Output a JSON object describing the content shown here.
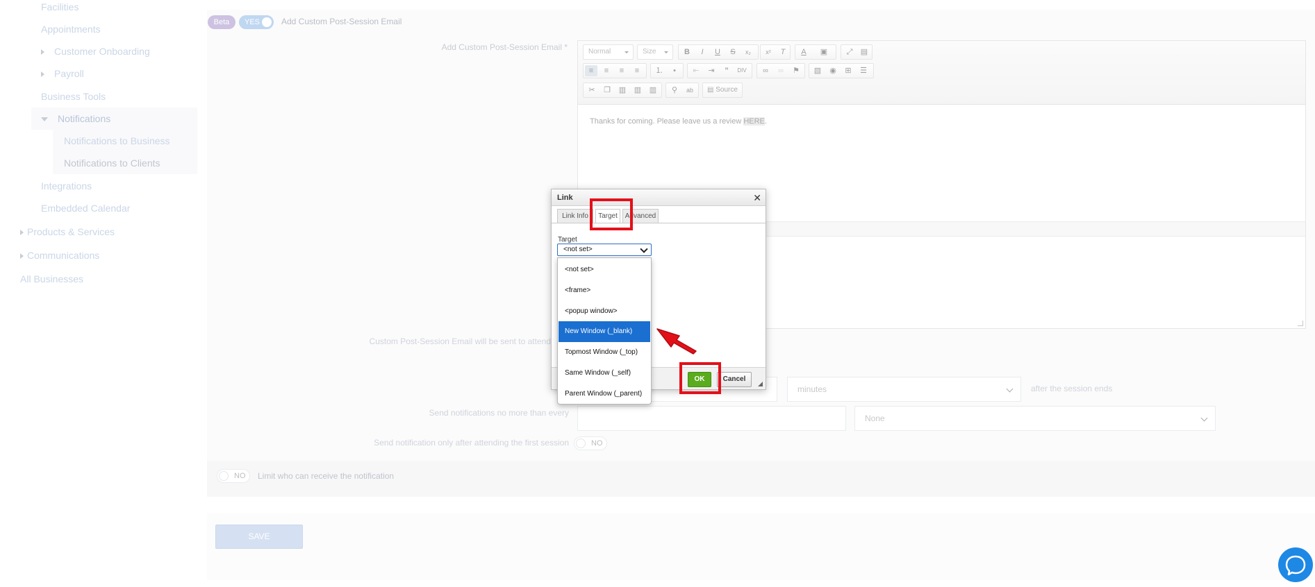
{
  "sidebar": {
    "items": [
      {
        "label": "Facilities"
      },
      {
        "label": "Appointments"
      },
      {
        "label": "Customer Onboarding"
      },
      {
        "label": "Payroll"
      },
      {
        "label": "Business Tools"
      },
      {
        "label": "Notifications"
      },
      {
        "label": "Notifications to Business"
      },
      {
        "label": "Notifications to Clients"
      },
      {
        "label": "Integrations"
      },
      {
        "label": "Embedded Calendar"
      },
      {
        "label": "Products & Services"
      },
      {
        "label": "Communications"
      },
      {
        "label": "All Businesses"
      }
    ]
  },
  "header": {
    "beta_badge": "Beta",
    "toggle_label": "YES",
    "title": "Add Custom Post-Session Email"
  },
  "form": {
    "email_label": "Add Custom Post-Session Email *",
    "sent_to_label": "Custom Post-Session Email will be sent to attend",
    "time_unit": "minutes",
    "after_text": "after the session ends",
    "no_more_label": "Send notifications no more than every",
    "no_more_unit": "None",
    "first_session_label": "Send notification only after attending the first session",
    "first_session_toggle": "NO",
    "limit_toggle": "NO",
    "limit_label": "Limit who can receive the notification",
    "save_button": "SAVE"
  },
  "editor": {
    "format_combo": "Normal",
    "size_combo": "Size",
    "source_button": "Source",
    "body_text": "Thanks for coming. Please leave us a review ",
    "body_link": "HERE",
    "body_end": "."
  },
  "dialog": {
    "title": "Link",
    "tabs": [
      "Link Info",
      "Target",
      "Advanced"
    ],
    "target_label": "Target",
    "target_value": "<not set>",
    "ok_button": "OK",
    "cancel_button": "Cancel",
    "options": [
      "<not set>",
      "<frame>",
      "<popup window>",
      "New Window (_blank)",
      "Topmost Window (_top)",
      "Same Window (_self)",
      "Parent Window (_parent)"
    ],
    "highlighted_option": "New Window (_blank)"
  },
  "colors": {
    "accent": "#1a6fd0",
    "annotation_red": "#e3101a",
    "ok_green": "#5bab1f",
    "beta_purple": "#a491c8",
    "sidebar_link": "#9fb4d3"
  }
}
